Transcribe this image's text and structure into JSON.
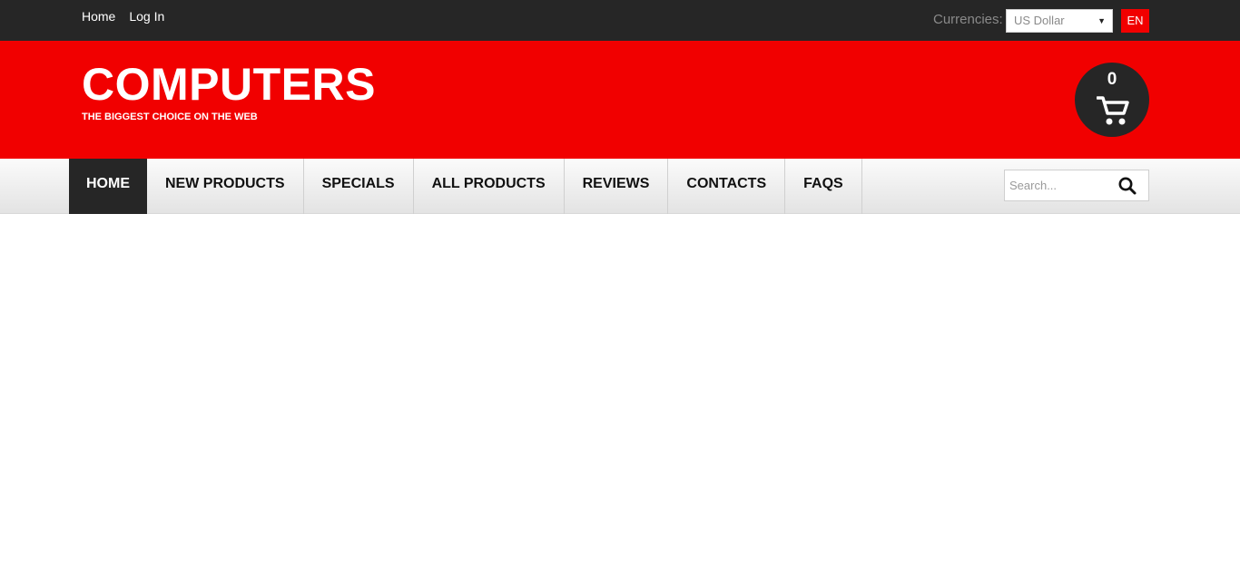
{
  "topbar": {
    "links": [
      "Home",
      "Log In"
    ],
    "currency_label": "Currencies:",
    "currency_selected": "US Dollar",
    "language": "EN"
  },
  "header": {
    "logo": "COMPUTERS",
    "tagline": "THE BIGGEST CHOICE ON THE WEB",
    "cart_count": "0",
    "cart_icon": "shopping-cart-icon"
  },
  "nav": {
    "items": [
      "HOME",
      "NEW PRODUCTS",
      "SPECIALS",
      "ALL PRODUCTS",
      "REVIEWS",
      "CONTACTS",
      "FAQS"
    ],
    "active": "HOME"
  },
  "search": {
    "placeholder": "Search...",
    "icon": "search-icon"
  },
  "colors": {
    "brand_red": "#f10000",
    "dark": "#262626"
  }
}
